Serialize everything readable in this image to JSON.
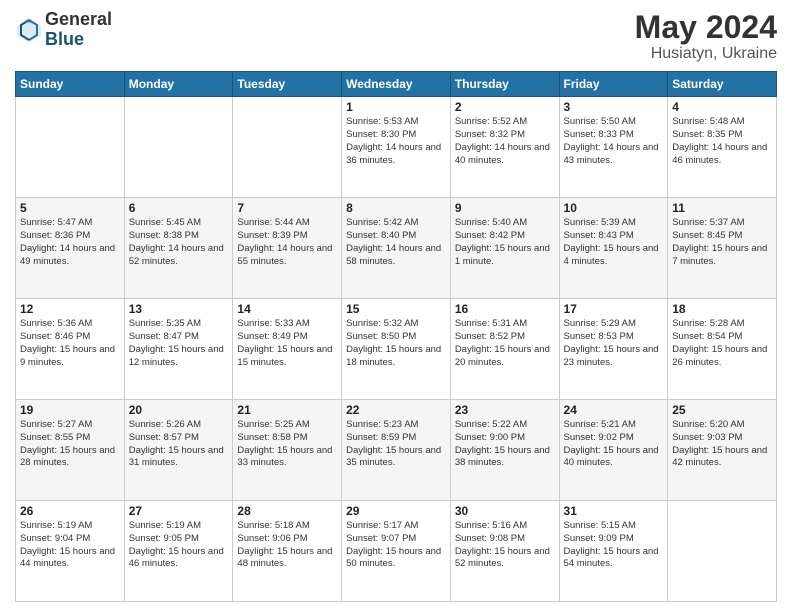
{
  "header": {
    "logo_general": "General",
    "logo_blue": "Blue",
    "month_title": "May 2024",
    "location": "Husiatyn, Ukraine"
  },
  "days_of_week": [
    "Sunday",
    "Monday",
    "Tuesday",
    "Wednesday",
    "Thursday",
    "Friday",
    "Saturday"
  ],
  "weeks": [
    [
      {
        "day": "",
        "info": ""
      },
      {
        "day": "",
        "info": ""
      },
      {
        "day": "",
        "info": ""
      },
      {
        "day": "1",
        "info": "Sunrise: 5:53 AM\nSunset: 8:30 PM\nDaylight: 14 hours\nand 36 minutes."
      },
      {
        "day": "2",
        "info": "Sunrise: 5:52 AM\nSunset: 8:32 PM\nDaylight: 14 hours\nand 40 minutes."
      },
      {
        "day": "3",
        "info": "Sunrise: 5:50 AM\nSunset: 8:33 PM\nDaylight: 14 hours\nand 43 minutes."
      },
      {
        "day": "4",
        "info": "Sunrise: 5:48 AM\nSunset: 8:35 PM\nDaylight: 14 hours\nand 46 minutes."
      }
    ],
    [
      {
        "day": "5",
        "info": "Sunrise: 5:47 AM\nSunset: 8:36 PM\nDaylight: 14 hours\nand 49 minutes."
      },
      {
        "day": "6",
        "info": "Sunrise: 5:45 AM\nSunset: 8:38 PM\nDaylight: 14 hours\nand 52 minutes."
      },
      {
        "day": "7",
        "info": "Sunrise: 5:44 AM\nSunset: 8:39 PM\nDaylight: 14 hours\nand 55 minutes."
      },
      {
        "day": "8",
        "info": "Sunrise: 5:42 AM\nSunset: 8:40 PM\nDaylight: 14 hours\nand 58 minutes."
      },
      {
        "day": "9",
        "info": "Sunrise: 5:40 AM\nSunset: 8:42 PM\nDaylight: 15 hours\nand 1 minute."
      },
      {
        "day": "10",
        "info": "Sunrise: 5:39 AM\nSunset: 8:43 PM\nDaylight: 15 hours\nand 4 minutes."
      },
      {
        "day": "11",
        "info": "Sunrise: 5:37 AM\nSunset: 8:45 PM\nDaylight: 15 hours\nand 7 minutes."
      }
    ],
    [
      {
        "day": "12",
        "info": "Sunrise: 5:36 AM\nSunset: 8:46 PM\nDaylight: 15 hours\nand 9 minutes."
      },
      {
        "day": "13",
        "info": "Sunrise: 5:35 AM\nSunset: 8:47 PM\nDaylight: 15 hours\nand 12 minutes."
      },
      {
        "day": "14",
        "info": "Sunrise: 5:33 AM\nSunset: 8:49 PM\nDaylight: 15 hours\nand 15 minutes."
      },
      {
        "day": "15",
        "info": "Sunrise: 5:32 AM\nSunset: 8:50 PM\nDaylight: 15 hours\nand 18 minutes."
      },
      {
        "day": "16",
        "info": "Sunrise: 5:31 AM\nSunset: 8:52 PM\nDaylight: 15 hours\nand 20 minutes."
      },
      {
        "day": "17",
        "info": "Sunrise: 5:29 AM\nSunset: 8:53 PM\nDaylight: 15 hours\nand 23 minutes."
      },
      {
        "day": "18",
        "info": "Sunrise: 5:28 AM\nSunset: 8:54 PM\nDaylight: 15 hours\nand 26 minutes."
      }
    ],
    [
      {
        "day": "19",
        "info": "Sunrise: 5:27 AM\nSunset: 8:55 PM\nDaylight: 15 hours\nand 28 minutes."
      },
      {
        "day": "20",
        "info": "Sunrise: 5:26 AM\nSunset: 8:57 PM\nDaylight: 15 hours\nand 31 minutes."
      },
      {
        "day": "21",
        "info": "Sunrise: 5:25 AM\nSunset: 8:58 PM\nDaylight: 15 hours\nand 33 minutes."
      },
      {
        "day": "22",
        "info": "Sunrise: 5:23 AM\nSunset: 8:59 PM\nDaylight: 15 hours\nand 35 minutes."
      },
      {
        "day": "23",
        "info": "Sunrise: 5:22 AM\nSunset: 9:00 PM\nDaylight: 15 hours\nand 38 minutes."
      },
      {
        "day": "24",
        "info": "Sunrise: 5:21 AM\nSunset: 9:02 PM\nDaylight: 15 hours\nand 40 minutes."
      },
      {
        "day": "25",
        "info": "Sunrise: 5:20 AM\nSunset: 9:03 PM\nDaylight: 15 hours\nand 42 minutes."
      }
    ],
    [
      {
        "day": "26",
        "info": "Sunrise: 5:19 AM\nSunset: 9:04 PM\nDaylight: 15 hours\nand 44 minutes."
      },
      {
        "day": "27",
        "info": "Sunrise: 5:19 AM\nSunset: 9:05 PM\nDaylight: 15 hours\nand 46 minutes."
      },
      {
        "day": "28",
        "info": "Sunrise: 5:18 AM\nSunset: 9:06 PM\nDaylight: 15 hours\nand 48 minutes."
      },
      {
        "day": "29",
        "info": "Sunrise: 5:17 AM\nSunset: 9:07 PM\nDaylight: 15 hours\nand 50 minutes."
      },
      {
        "day": "30",
        "info": "Sunrise: 5:16 AM\nSunset: 9:08 PM\nDaylight: 15 hours\nand 52 minutes."
      },
      {
        "day": "31",
        "info": "Sunrise: 5:15 AM\nSunset: 9:09 PM\nDaylight: 15 hours\nand 54 minutes."
      },
      {
        "day": "",
        "info": ""
      }
    ]
  ]
}
